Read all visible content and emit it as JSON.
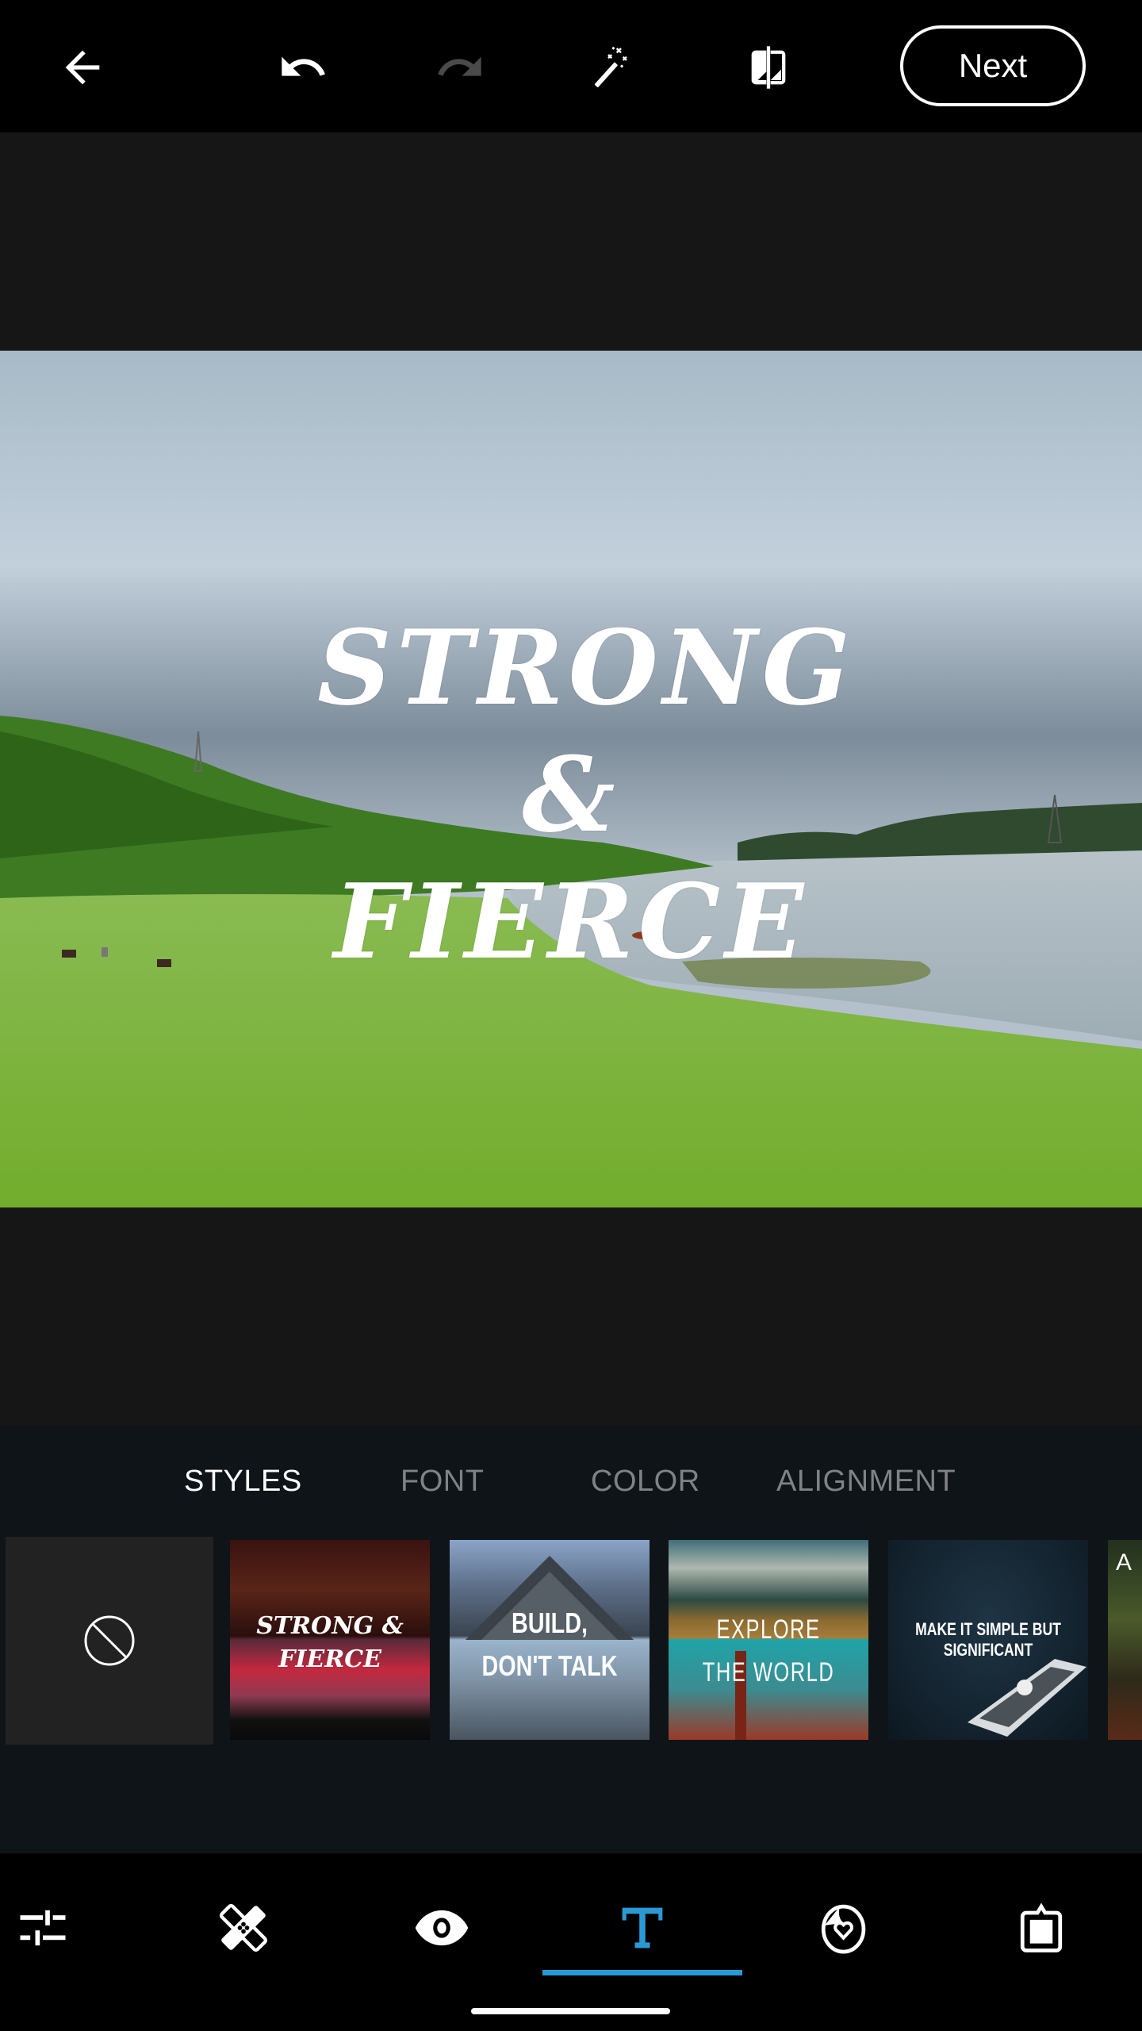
{
  "app": {
    "accent_color": "#2b9ad4"
  },
  "topbar": {
    "back_icon": "arrow-left",
    "undo_icon": "undo",
    "redo_icon": "redo (disabled)",
    "auto_fix_icon": "magic-wand",
    "compare_icon": "compare",
    "next_label": "Next"
  },
  "canvas": {
    "overlay_text_line1": "STRONG",
    "overlay_text_line2": "& FIERCE"
  },
  "text_panel": {
    "tabs": [
      {
        "label": "STYLES",
        "active": true
      },
      {
        "label": "FONT",
        "active": false
      },
      {
        "label": "COLOR",
        "active": false
      },
      {
        "label": "ALIGNMENT",
        "active": false
      }
    ],
    "styles": [
      {
        "name": "none",
        "icon": "no-style"
      },
      {
        "caption_line1": "STRONG &",
        "caption_line2": "FIERCE"
      },
      {
        "caption_line1": "BUILD,",
        "caption_line2": "DON'T TALK"
      },
      {
        "caption_line1": "EXPLORE",
        "caption_line2": "THE WORLD"
      },
      {
        "caption_line1": "MAKE IT SIMPLE BUT",
        "caption_line2": "SIGNIFICANT"
      },
      {
        "caption_line1": "A",
        "caption_line2": ""
      }
    ]
  },
  "bottom_nav": {
    "items": [
      {
        "icon": "adjustments-sliders",
        "active": false
      },
      {
        "icon": "healing-bandage",
        "active": false
      },
      {
        "icon": "eye",
        "active": false
      },
      {
        "icon": "text-T",
        "active": true
      },
      {
        "icon": "sticker",
        "active": false
      },
      {
        "icon": "frame-border",
        "active": false
      }
    ]
  }
}
